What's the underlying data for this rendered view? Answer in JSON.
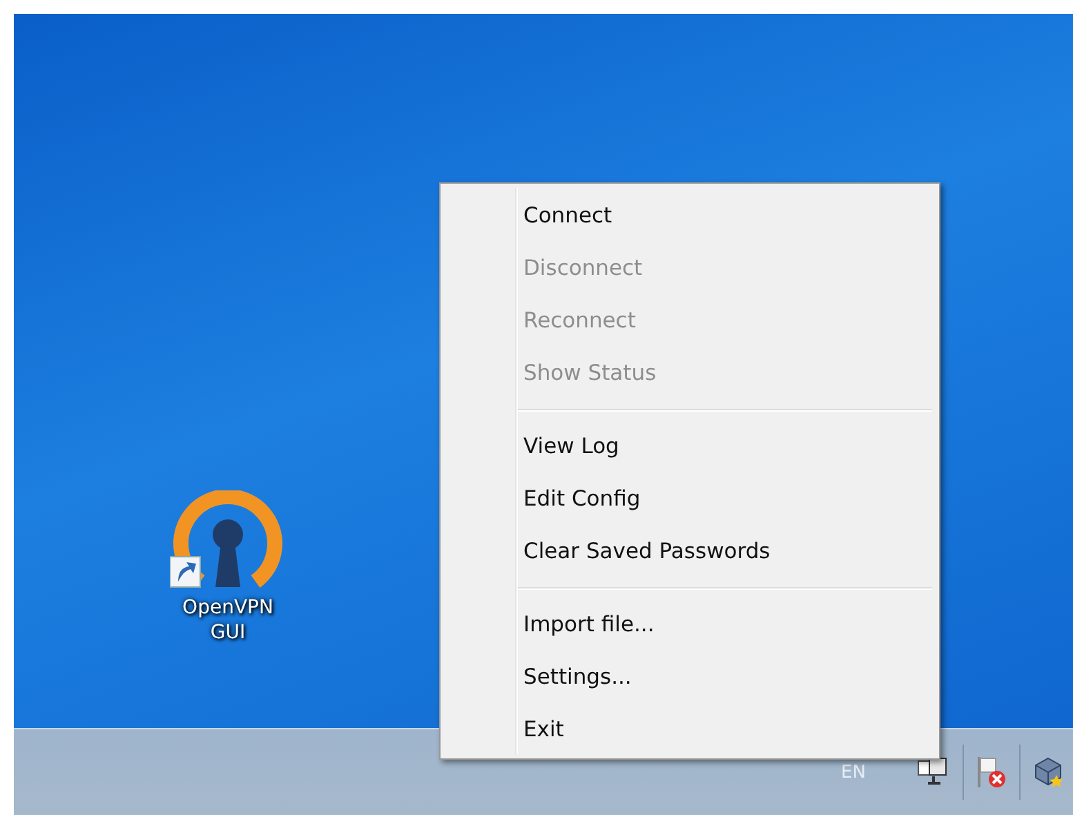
{
  "desktop_icon": {
    "label_lines": [
      "OpenVPN",
      "GUI"
    ]
  },
  "context_menu": {
    "groups": [
      [
        {
          "label": "Connect",
          "disabled": false
        },
        {
          "label": "Disconnect",
          "disabled": true
        },
        {
          "label": "Reconnect",
          "disabled": true
        },
        {
          "label": "Show Status",
          "disabled": true
        }
      ],
      [
        {
          "label": "View Log",
          "disabled": false
        },
        {
          "label": "Edit Config",
          "disabled": false
        },
        {
          "label": "Clear Saved Passwords",
          "disabled": false
        }
      ],
      [
        {
          "label": "Import file...",
          "disabled": false
        },
        {
          "label": "Settings...",
          "disabled": false
        },
        {
          "label": "Exit",
          "disabled": false
        }
      ]
    ]
  },
  "taskbar": {
    "language": "EN"
  }
}
